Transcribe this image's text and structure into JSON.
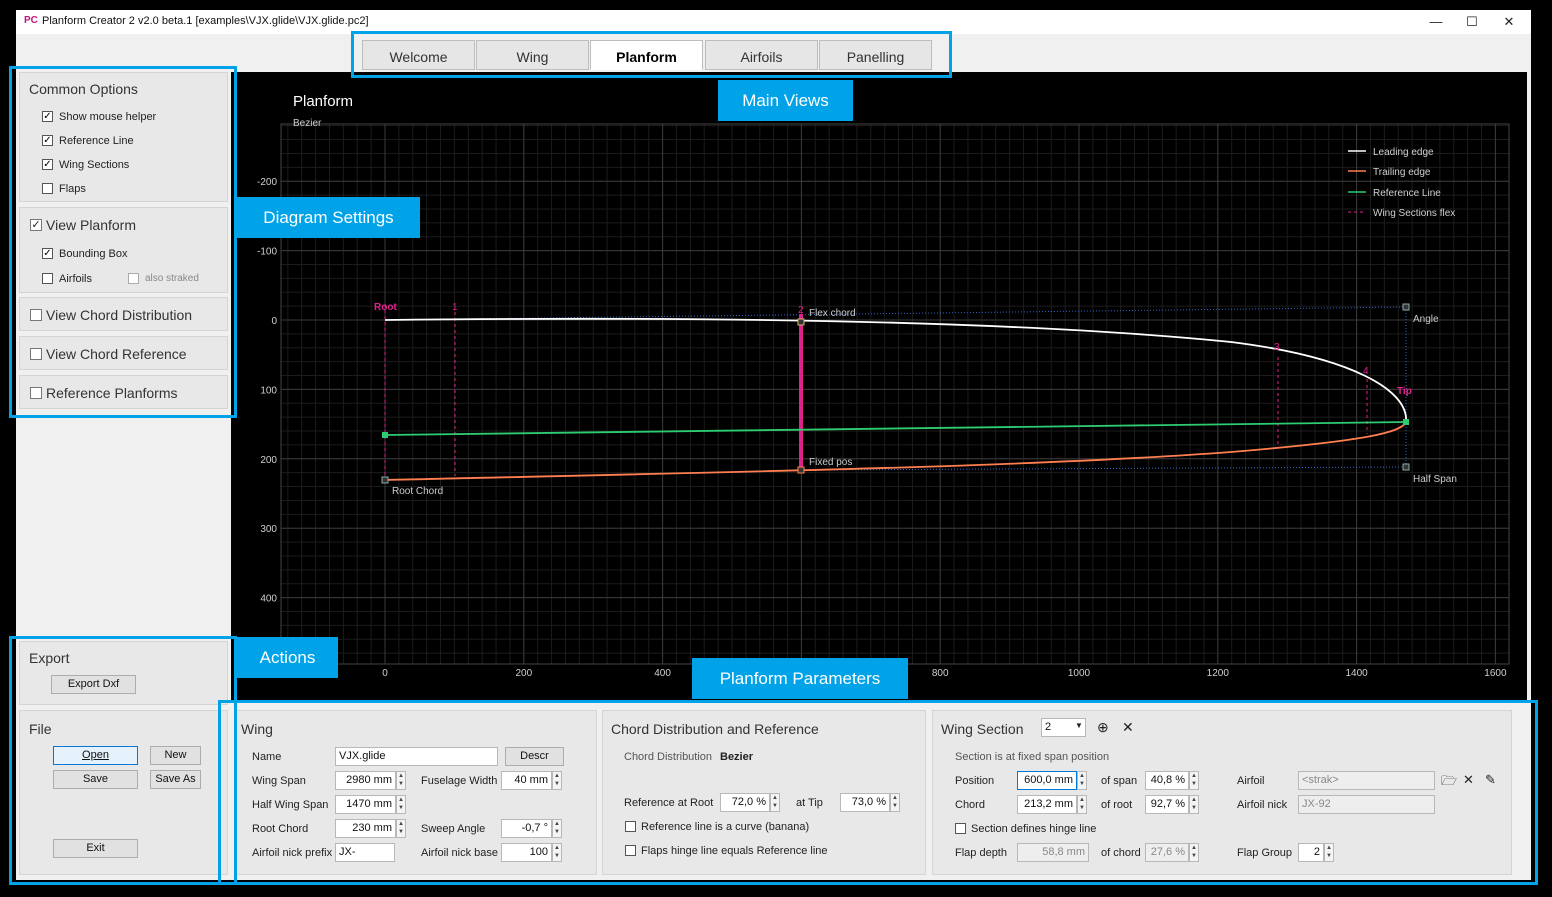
{
  "titlebar": {
    "logo": "PC",
    "title": "Planform Creator 2  v2.0 beta.1  [examples\\VJX.glide\\VJX.glide.pc2]"
  },
  "tabs": [
    {
      "label": "Welcome"
    },
    {
      "label": "Wing"
    },
    {
      "label": "Planform",
      "active": true
    },
    {
      "label": "Airfoils"
    },
    {
      "label": "Panelling"
    }
  ],
  "annotations": {
    "main_views": "Main Views",
    "diagram_settings": "Diagram Settings",
    "actions": "Actions",
    "planform_parameters": "Planform Parameters"
  },
  "common_options": {
    "title": "Common Options",
    "items": [
      {
        "label": "Show mouse helper",
        "checked": true
      },
      {
        "label": "Reference Line",
        "checked": true
      },
      {
        "label": "Wing Sections",
        "checked": true
      },
      {
        "label": "Flaps",
        "checked": false
      }
    ]
  },
  "view_planform": {
    "label": "View Planform",
    "checked": true,
    "bounding_box": {
      "label": "Bounding Box",
      "checked": true
    },
    "airfoils": {
      "label": "Airfoils",
      "checked": false
    },
    "also_straked": {
      "label": "also straked",
      "checked": false
    }
  },
  "view_chord_distribution": {
    "label": "View Chord Distribution",
    "checked": false
  },
  "view_chord_reference": {
    "label": "View Chord Reference",
    "checked": false
  },
  "reference_planforms": {
    "label": "Reference Planforms",
    "checked": false
  },
  "export": {
    "title": "Export",
    "export_dxf": "Export Dxf"
  },
  "file": {
    "title": "File",
    "open": "Open",
    "new": "New",
    "save": "Save",
    "save_as": "Save As",
    "exit": "Exit"
  },
  "plot": {
    "title": "Planform",
    "subtitle": "Bezier",
    "x_ticks": [
      "0",
      "200",
      "400",
      "600",
      "800",
      "1000",
      "1200",
      "1400",
      "1600"
    ],
    "y_ticks": [
      "-200",
      "-100",
      "0",
      "100",
      "200",
      "300",
      "400"
    ],
    "legend": [
      {
        "label": "Leading edge",
        "color": "#ffffff"
      },
      {
        "label": "Trailing edge",
        "color": "#ff7f50"
      },
      {
        "label": "Reference Line",
        "color": "#2ecc71"
      },
      {
        "label": "Wing Sections flex",
        "color": "#e0218a"
      }
    ],
    "labels": {
      "root": "Root",
      "root_chord": "Root Chord",
      "flex_chord": "Flex chord",
      "fixed_pos": "Fixed pos",
      "angle": "Angle",
      "tip": "Tip",
      "half_span": "Half Span",
      "section_1": "1",
      "section_2": "2",
      "section_3": "3",
      "section_4": "4"
    }
  },
  "wing": {
    "title": "Wing",
    "name_label": "Name",
    "name": "VJX.glide",
    "descr": "Descr",
    "wing_span_label": "Wing Span",
    "wing_span": "2980 mm",
    "fuselage_width_label": "Fuselage Width",
    "fuselage_width": "40 mm",
    "half_wing_span_label": "Half Wing Span",
    "half_wing_span": "1470 mm",
    "root_chord_label": "Root Chord",
    "root_chord": "230 mm",
    "sweep_angle_label": "Sweep Angle",
    "sweep_angle": "-0,7 °",
    "airfoil_nick_prefix_label": "Airfoil nick prefix",
    "airfoil_nick_prefix": "JX-",
    "airfoil_nick_base_label": "Airfoil nick base",
    "airfoil_nick_base": "100"
  },
  "chord": {
    "title": "Chord Distribution and Reference",
    "distribution_label": "Chord Distribution",
    "distribution": "Bezier",
    "ref_root_label": "Reference at Root",
    "ref_root": "72,0 %",
    "at_tip_label": "at Tip",
    "at_tip": "73,0 %",
    "banana_label": "Reference line is a curve (banana)",
    "flaps_hinge_label": "Flaps hinge line equals Reference line"
  },
  "section": {
    "title": "Wing Section",
    "selected": "2",
    "info": "Section is at fixed span position",
    "position_label": "Position",
    "position": "600,0 mm",
    "of_span_label": "of span",
    "of_span": "40,8 %",
    "airfoil_label": "Airfoil",
    "airfoil": "<strak>",
    "chord_label": "Chord",
    "chord": "213,2 mm",
    "of_root_label": "of root",
    "of_root": "92,7 %",
    "airfoil_nick_label": "Airfoil nick",
    "airfoil_nick": "JX-92",
    "hinge_label": "Section defines hinge line",
    "flap_depth_label": "Flap depth",
    "flap_depth": "58,8 mm",
    "of_chord_label": "of chord",
    "of_chord": "27,6 %",
    "flap_group_label": "Flap Group",
    "flap_group": "2"
  }
}
